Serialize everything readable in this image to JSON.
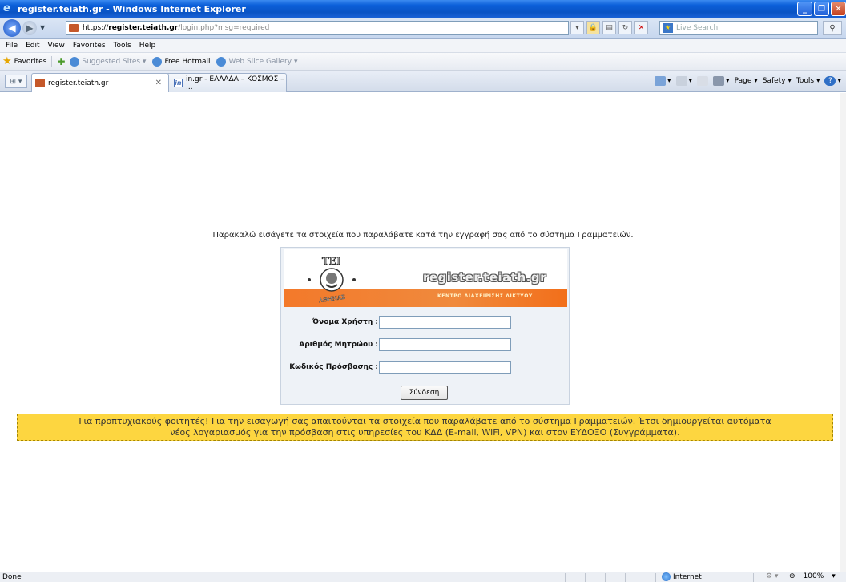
{
  "window": {
    "title": "register.teiath.gr - Windows Internet Explorer"
  },
  "address": {
    "scheme": "https://",
    "host": "register.teiath.gr",
    "path": "/login.php?msg=required",
    "search_placeholder": "Live Search"
  },
  "menu": [
    "File",
    "Edit",
    "View",
    "Favorites",
    "Tools",
    "Help"
  ],
  "favorites": {
    "label": "Favorites",
    "items": [
      "Suggested Sites ▾",
      "Free Hotmail",
      "Web Slice Gallery ▾"
    ]
  },
  "tabs": [
    {
      "label": "register.teiath.gr"
    },
    {
      "label": "in.gr - ΕΛΛΑΔΑ – ΚΟΣΜΟΣ – ..."
    }
  ],
  "commandbar": {
    "page": "Page ▾",
    "safety": "Safety ▾",
    "tools": "Tools ▾"
  },
  "page": {
    "instruction": "Παρακαλώ εισάγετε τα στοιχεία που παραλάβατε κατά την εγγραφή σας από το σύστημα Γραμματειών.",
    "logo_title": "register.teiath.gr",
    "logo_subtitle": "ΚΕΝΤΡΟ ΔΙΑΧΕΙΡΙΣΗΣ ΔΙΚΤΥΟΥ",
    "logo_emblem_top": "ΤΕΙ",
    "logo_emblem_bottom": "ΑΘΗΝΑΣ",
    "fields": [
      {
        "label": "Όνομα Χρήστη :",
        "value": ""
      },
      {
        "label": "Αριθμός Μητρώου :",
        "value": ""
      },
      {
        "label": "Κωδικός Πρόσβασης :",
        "value": ""
      }
    ],
    "login_button": "Σύνδεση",
    "notice_line1": "Για προπτυχιακούς φοιτητές! Για την εισαγωγή σας απαιτούνται τα στοιχεία που παραλάβατε από το σύστημα Γραμματειών. Έτσι δημιουργείται αυτόματα",
    "notice_line2": "νέος λογαριασμός για την πρόσβαση στις υπηρεσίες του ΚΔΔ (E-mail, WiFi, VPN) και στον ΕΥΔΟΞΟ (Συγγράμματα)."
  },
  "status": {
    "text": "Done",
    "zone": "Internet",
    "zoom": "100%"
  },
  "colors": {
    "notice_bg": "#fdd640",
    "logo_orange": "#f3792a"
  }
}
